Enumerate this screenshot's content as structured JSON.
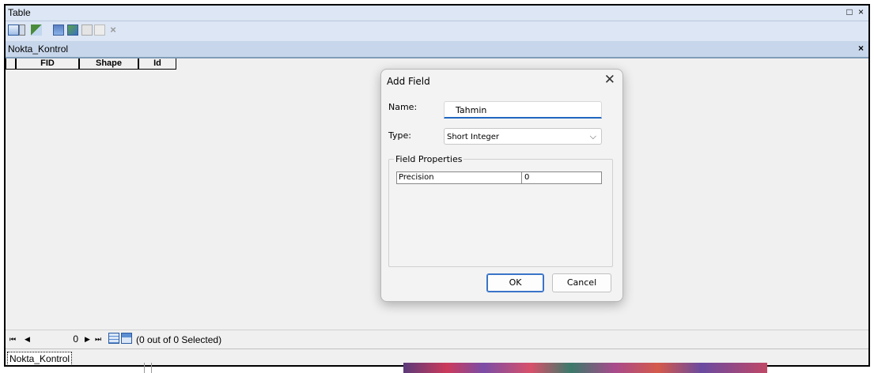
{
  "window": {
    "title": "Table",
    "buttons": "□ ×"
  },
  "toolbar": {
    "icons": [
      "table-options-icon",
      "dropdown-arrow-icon",
      "related-tables-icon",
      "select-by-attributes-icon",
      "switch-selection-icon",
      "clear-selection-icon",
      "zoom-to-selected-icon",
      "delete-selected-icon"
    ]
  },
  "tab": {
    "name": "Nokta_Kontrol",
    "close": "×"
  },
  "table": {
    "columns": [
      "FID",
      "Shape",
      "Id"
    ]
  },
  "status": {
    "first": "⏮",
    "prev": "◀",
    "record": "0",
    "next": "▶",
    "last": "⏭",
    "selection": "(0 out of 0 Selected)"
  },
  "bottom_tab": {
    "name": "Nokta_Kontrol"
  },
  "dialog": {
    "title": "Add Field",
    "close": "✕",
    "name_label": "Name:",
    "name_value": "Tahmin",
    "type_label": "Type:",
    "type_value": "Short Integer",
    "chevron": "⌵",
    "group_title": "Field Properties",
    "properties": [
      {
        "name": "Precision",
        "value": "0"
      }
    ],
    "ok": "OK",
    "cancel": "Cancel"
  }
}
